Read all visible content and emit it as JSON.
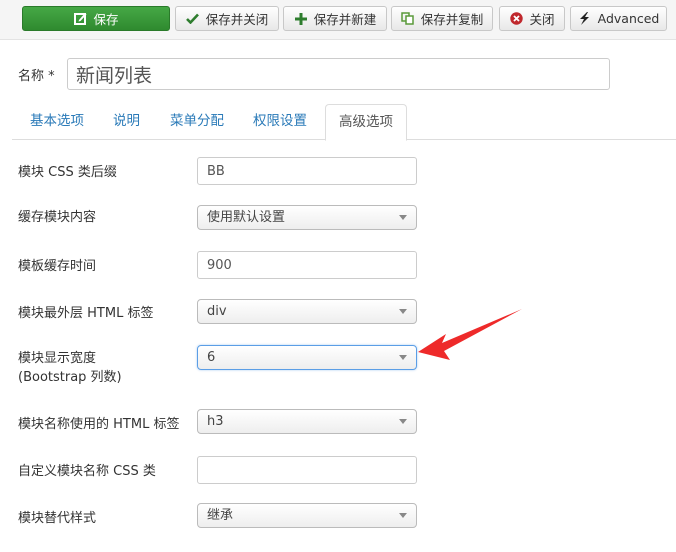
{
  "toolbar": {
    "buttons": [
      {
        "label": "保存",
        "icon": "edit-icon"
      },
      {
        "label": "保存并关闭",
        "icon": "check-icon"
      },
      {
        "label": "保存并新建",
        "icon": "plus-icon"
      },
      {
        "label": "保存并复制",
        "icon": "copy-icon"
      },
      {
        "label": "关闭",
        "icon": "close-circle-icon"
      },
      {
        "label": "Advanced",
        "icon": "bolt-icon"
      }
    ]
  },
  "title_field": {
    "label": "名称 *",
    "value": "新闻列表"
  },
  "tabs": [
    {
      "label": "基本选项",
      "active": false
    },
    {
      "label": "说明",
      "active": false
    },
    {
      "label": "菜单分配",
      "active": false
    },
    {
      "label": "权限设置",
      "active": false
    },
    {
      "label": "高级选项",
      "active": true
    }
  ],
  "fields": [
    {
      "label": "模块 CSS 类后缀",
      "type": "text",
      "value": "BB"
    },
    {
      "label": "缓存模块内容",
      "type": "select",
      "value": "使用默认设置"
    },
    {
      "label": "模板缓存时间",
      "type": "text",
      "value": "900"
    },
    {
      "label": "模块最外层 HTML 标签",
      "type": "select",
      "value": "div"
    },
    {
      "label": "模块显示宽度",
      "label2": "(Bootstrap 列数)",
      "type": "select",
      "value": "6"
    },
    {
      "label": "模块名称使用的 HTML 标签",
      "type": "select",
      "value": "h3"
    },
    {
      "label": "自定义模块名称 CSS 类",
      "type": "text",
      "value": ""
    },
    {
      "label": "模块替代样式",
      "type": "select",
      "value": "继承"
    }
  ],
  "colors": {
    "save_green": "#3a9a3a",
    "tab_link": "#2a7ab8",
    "annotation_arrow": "#ee2a2a",
    "focus_border": "#5b9ee6"
  }
}
